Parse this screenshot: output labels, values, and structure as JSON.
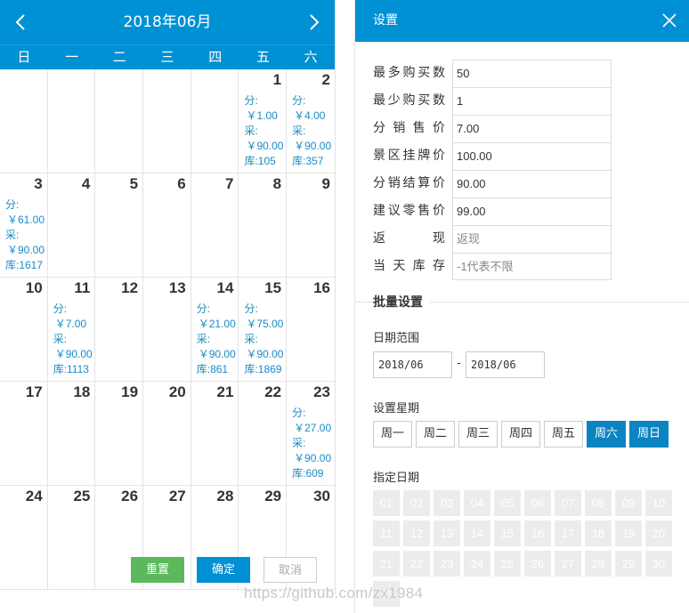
{
  "calendar": {
    "title": "2018年06月",
    "weekdays": [
      "日",
      "一",
      "二",
      "三",
      "四",
      "五",
      "六"
    ],
    "weeks": [
      [
        {
          "day": ""
        },
        {
          "day": ""
        },
        {
          "day": ""
        },
        {
          "day": ""
        },
        {
          "day": ""
        },
        {
          "day": "1",
          "fen": "分:",
          "fen_price": "￥1.00",
          "cai": "采:",
          "cai_price": "￥90.00",
          "ku": "库:105"
        },
        {
          "day": "2",
          "fen": "分:",
          "fen_price": "￥4.00",
          "cai": "采:",
          "cai_price": "￥90.00",
          "ku": "库:357"
        }
      ],
      [
        {
          "day": "3",
          "fen": "分:",
          "fen_price": "￥61.00",
          "cai": "采:",
          "cai_price": "￥90.00",
          "ku": "库:1617"
        },
        {
          "day": "4"
        },
        {
          "day": "5"
        },
        {
          "day": "6"
        },
        {
          "day": "7"
        },
        {
          "day": "8"
        },
        {
          "day": "9"
        }
      ],
      [
        {
          "day": "10"
        },
        {
          "day": "11",
          "fen": "分:",
          "fen_price": "￥7.00",
          "cai": "采:",
          "cai_price": "￥90.00",
          "ku": "库:1113"
        },
        {
          "day": "12"
        },
        {
          "day": "13"
        },
        {
          "day": "14",
          "fen": "分:",
          "fen_price": "￥21.00",
          "cai": "采:",
          "cai_price": "￥90.00",
          "ku": "库:861"
        },
        {
          "day": "15",
          "fen": "分:",
          "fen_price": "￥75.00",
          "cai": "采:",
          "cai_price": "￥90.00",
          "ku": "库:1869"
        },
        {
          "day": "16"
        }
      ],
      [
        {
          "day": "17"
        },
        {
          "day": "18"
        },
        {
          "day": "19"
        },
        {
          "day": "20"
        },
        {
          "day": "21"
        },
        {
          "day": "22"
        },
        {
          "day": "23",
          "fen": "分:",
          "fen_price": "￥27.00",
          "cai": "采:",
          "cai_price": "￥90.00",
          "ku": "库:609"
        }
      ],
      [
        {
          "day": "24"
        },
        {
          "day": "25"
        },
        {
          "day": "26"
        },
        {
          "day": "27"
        },
        {
          "day": "28"
        },
        {
          "day": "29"
        },
        {
          "day": "30"
        }
      ]
    ],
    "buttons": {
      "reset": "重置",
      "confirm": "确定",
      "cancel": "取消"
    }
  },
  "settings": {
    "title": "设置",
    "fields": [
      {
        "label": "最多购买数",
        "value": "50",
        "placeholder": false
      },
      {
        "label": "最少购买数",
        "value": "1",
        "placeholder": false
      },
      {
        "label": "分销售价",
        "value": "7.00",
        "placeholder": false
      },
      {
        "label": "景区挂牌价",
        "value": "100.00",
        "placeholder": false
      },
      {
        "label": "分销结算价",
        "value": "90.00",
        "placeholder": false
      },
      {
        "label": "建议零售价",
        "value": "99.00",
        "placeholder": false
      },
      {
        "label": "返现",
        "value": "返现",
        "placeholder": true
      },
      {
        "label": "当天库存",
        "value": "-1代表不限",
        "placeholder": true
      }
    ],
    "batch": {
      "title": "批量设置",
      "date_range_label": "日期范围",
      "date_from": "2018/06",
      "date_sep": "-",
      "date_to": "2018/06",
      "week_label": "设置星期",
      "week_days": [
        {
          "label": "周一",
          "selected": false
        },
        {
          "label": "周二",
          "selected": false
        },
        {
          "label": "周三",
          "selected": false
        },
        {
          "label": "周四",
          "selected": false
        },
        {
          "label": "周五",
          "selected": false
        },
        {
          "label": "周六",
          "selected": true
        },
        {
          "label": "周日",
          "selected": true
        }
      ],
      "specific_dates_label": "指定日期",
      "dates": [
        "01",
        "02",
        "03",
        "04",
        "05",
        "06",
        "07",
        "08",
        "09",
        "10",
        "11",
        "12",
        "13",
        "14",
        "15",
        "16",
        "17",
        "18",
        "19",
        "20",
        "21",
        "22",
        "23",
        "24",
        "25",
        "26",
        "27",
        "28",
        "29",
        "30",
        "31"
      ]
    }
  },
  "watermark": "https://github.com/zx1984",
  "colors": {
    "primary": "#0090d4",
    "accent_text": "#1a8ac6",
    "reset": "#5cb85c",
    "date_chip": "#ececec"
  }
}
